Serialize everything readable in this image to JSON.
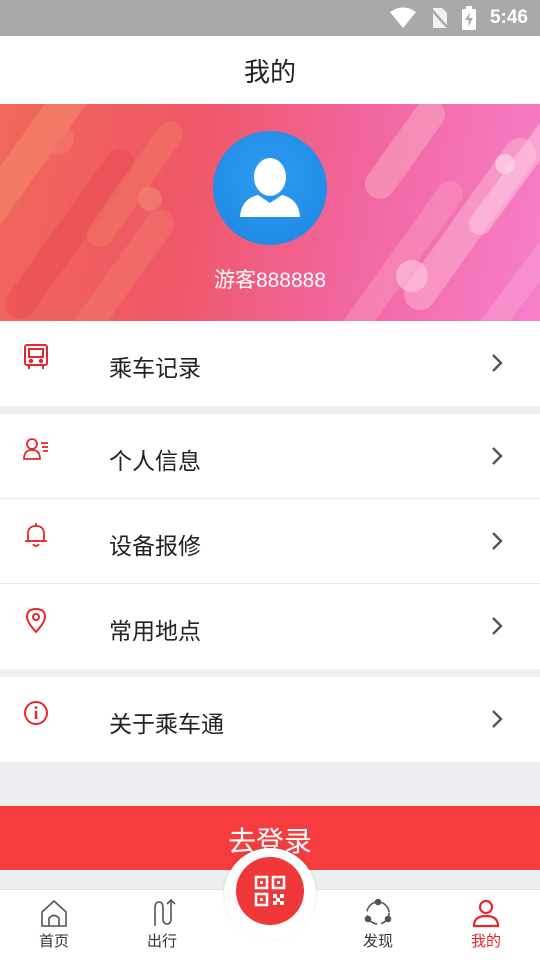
{
  "status_bar": {
    "time": "5:46",
    "icons": [
      "wifi-icon",
      "no-sim-icon",
      "battery-charging-icon"
    ]
  },
  "header": {
    "title": "我的"
  },
  "profile": {
    "username": "游客888888",
    "avatar_icon": "user-avatar-icon"
  },
  "menu": [
    {
      "id": "ride-records",
      "label": "乘车记录",
      "icon": "bus-icon"
    },
    {
      "id": "personal-info",
      "label": "个人信息",
      "icon": "user-info-icon"
    },
    {
      "id": "device-repair",
      "label": "设备报修",
      "icon": "bell-icon"
    },
    {
      "id": "common-places",
      "label": "常用地点",
      "icon": "location-pin-icon"
    },
    {
      "id": "about",
      "label": "关于乘车通",
      "icon": "info-icon"
    }
  ],
  "login_button": {
    "label": "去登录"
  },
  "tabs": [
    {
      "id": "home",
      "label": "首页",
      "icon": "home-icon",
      "active": false
    },
    {
      "id": "travel",
      "label": "出行",
      "icon": "route-icon",
      "active": false
    },
    {
      "id": "discover",
      "label": "发现",
      "icon": "discover-icon",
      "active": false
    },
    {
      "id": "mine",
      "label": "我的",
      "icon": "person-icon",
      "active": true
    }
  ],
  "scan_button": {
    "icon": "qr-code-icon"
  },
  "colors": {
    "accent": "#f53c3e",
    "icon_red": "#e8262b",
    "avatar_blue": "#1d85e3"
  }
}
